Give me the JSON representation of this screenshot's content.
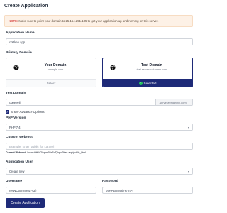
{
  "page": {
    "title": "Create Application"
  },
  "note": {
    "prefix": "NOTE:",
    "text": "Make sure to point your domain to 25.154.251.135 to get your application up and running on this server."
  },
  "app_name": {
    "label": "Application Name",
    "value": "coPkeu app"
  },
  "primary_domain": {
    "label": "Primary Domain",
    "options": [
      {
        "name": "Your Domain",
        "sub": "example.com",
        "footer": "Select",
        "selected": false
      },
      {
        "name": "Test Domain",
        "sub": "test.serveravatartmp.com",
        "footer": "Selected",
        "selected": true
      }
    ]
  },
  "test_domain": {
    "label": "Test Domain",
    "value": "copeeeil",
    "suffix": ".serveravatartmp.com"
  },
  "advanced": {
    "label": "Show Advance Options",
    "checked": true
  },
  "php_version": {
    "label": "PHP Version",
    "value": "PHP 7.4"
  },
  "webroot": {
    "label": "Custom webroot",
    "placeholder": "Example: Enter 'public' for Laravel",
    "current_label": "Current Webroot:",
    "current_value": "/home/rtHWO0qrmR0zFcZ)/cpoPkeu-app/public_html"
  },
  "app_user": {
    "label": "Application User",
    "value": "Create new"
  },
  "username": {
    "label": "Username",
    "value": "rtHWO0qrmR0zFcZ)"
  },
  "password": {
    "label": "Password",
    "value": "09HPEnnvtabY7TtPI"
  },
  "submit": {
    "label": "Create Application"
  },
  "colors": {
    "primary": "#1e2a78",
    "note_bg": "#fdf1e6",
    "note_prefix": "#d9534f",
    "success": "#22c55e"
  }
}
